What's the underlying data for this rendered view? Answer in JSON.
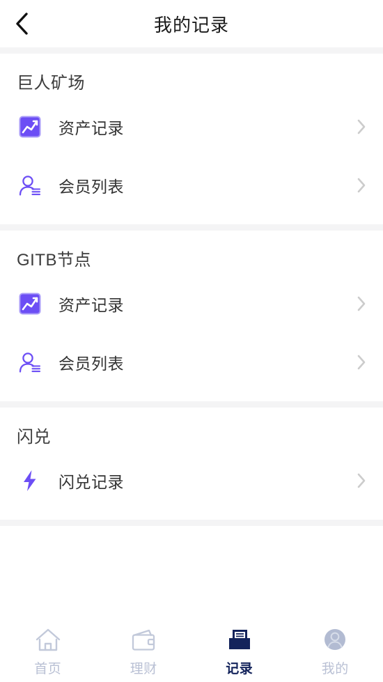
{
  "header": {
    "title": "我的记录",
    "back_icon": "chevron-left-icon"
  },
  "colors": {
    "accent_purple": "#6c4ef5",
    "icon_inactive": "#c2c9da",
    "tab_active": "#13235b",
    "separator": "#f4f4f5",
    "chevron": "#cccccc"
  },
  "sections": [
    {
      "title": "巨人矿场",
      "items": [
        {
          "label": "资产记录",
          "icon": "chart-square-icon"
        },
        {
          "label": "会员列表",
          "icon": "member-list-icon"
        }
      ]
    },
    {
      "title": "GITB节点",
      "items": [
        {
          "label": "资产记录",
          "icon": "chart-square-icon"
        },
        {
          "label": "会员列表",
          "icon": "member-list-icon"
        }
      ]
    },
    {
      "title": "闪兑",
      "items": [
        {
          "label": "闪兑记录",
          "icon": "lightning-bolt-icon"
        }
      ]
    }
  ],
  "tabbar": {
    "tabs": [
      {
        "label": "首页",
        "icon": "home-icon",
        "active": false
      },
      {
        "label": "理财",
        "icon": "wallet-icon",
        "active": false
      },
      {
        "label": "记录",
        "icon": "records-icon",
        "active": true
      },
      {
        "label": "我的",
        "icon": "profile-avatar-icon",
        "active": false
      }
    ]
  }
}
